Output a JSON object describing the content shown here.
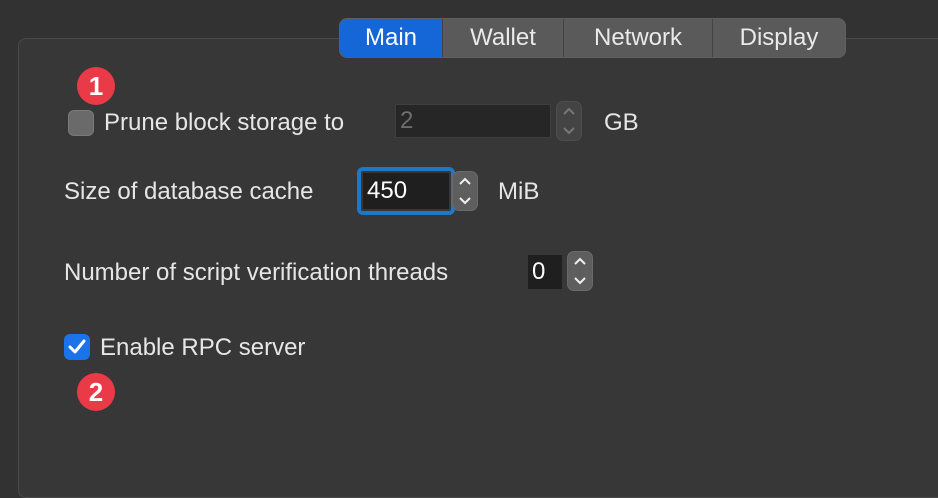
{
  "tabs": [
    {
      "label": "Main",
      "active": true
    },
    {
      "label": "Wallet",
      "active": false
    },
    {
      "label": "Network",
      "active": false
    },
    {
      "label": "Display",
      "active": false
    }
  ],
  "badges": {
    "first": "1",
    "second": "2"
  },
  "prune": {
    "label": "Prune block storage to",
    "checked": false,
    "value": "2",
    "unit": "GB",
    "enabled": false
  },
  "dbcache": {
    "label": "Size of database cache",
    "value": "450",
    "unit": "MiB"
  },
  "threads": {
    "label": "Number of script verification threads",
    "value": "0"
  },
  "rpc": {
    "label": "Enable RPC server",
    "checked": true
  },
  "colors": {
    "accent": "#1566d6",
    "badge": "#ea3a48",
    "focus": "#1e78c8"
  }
}
